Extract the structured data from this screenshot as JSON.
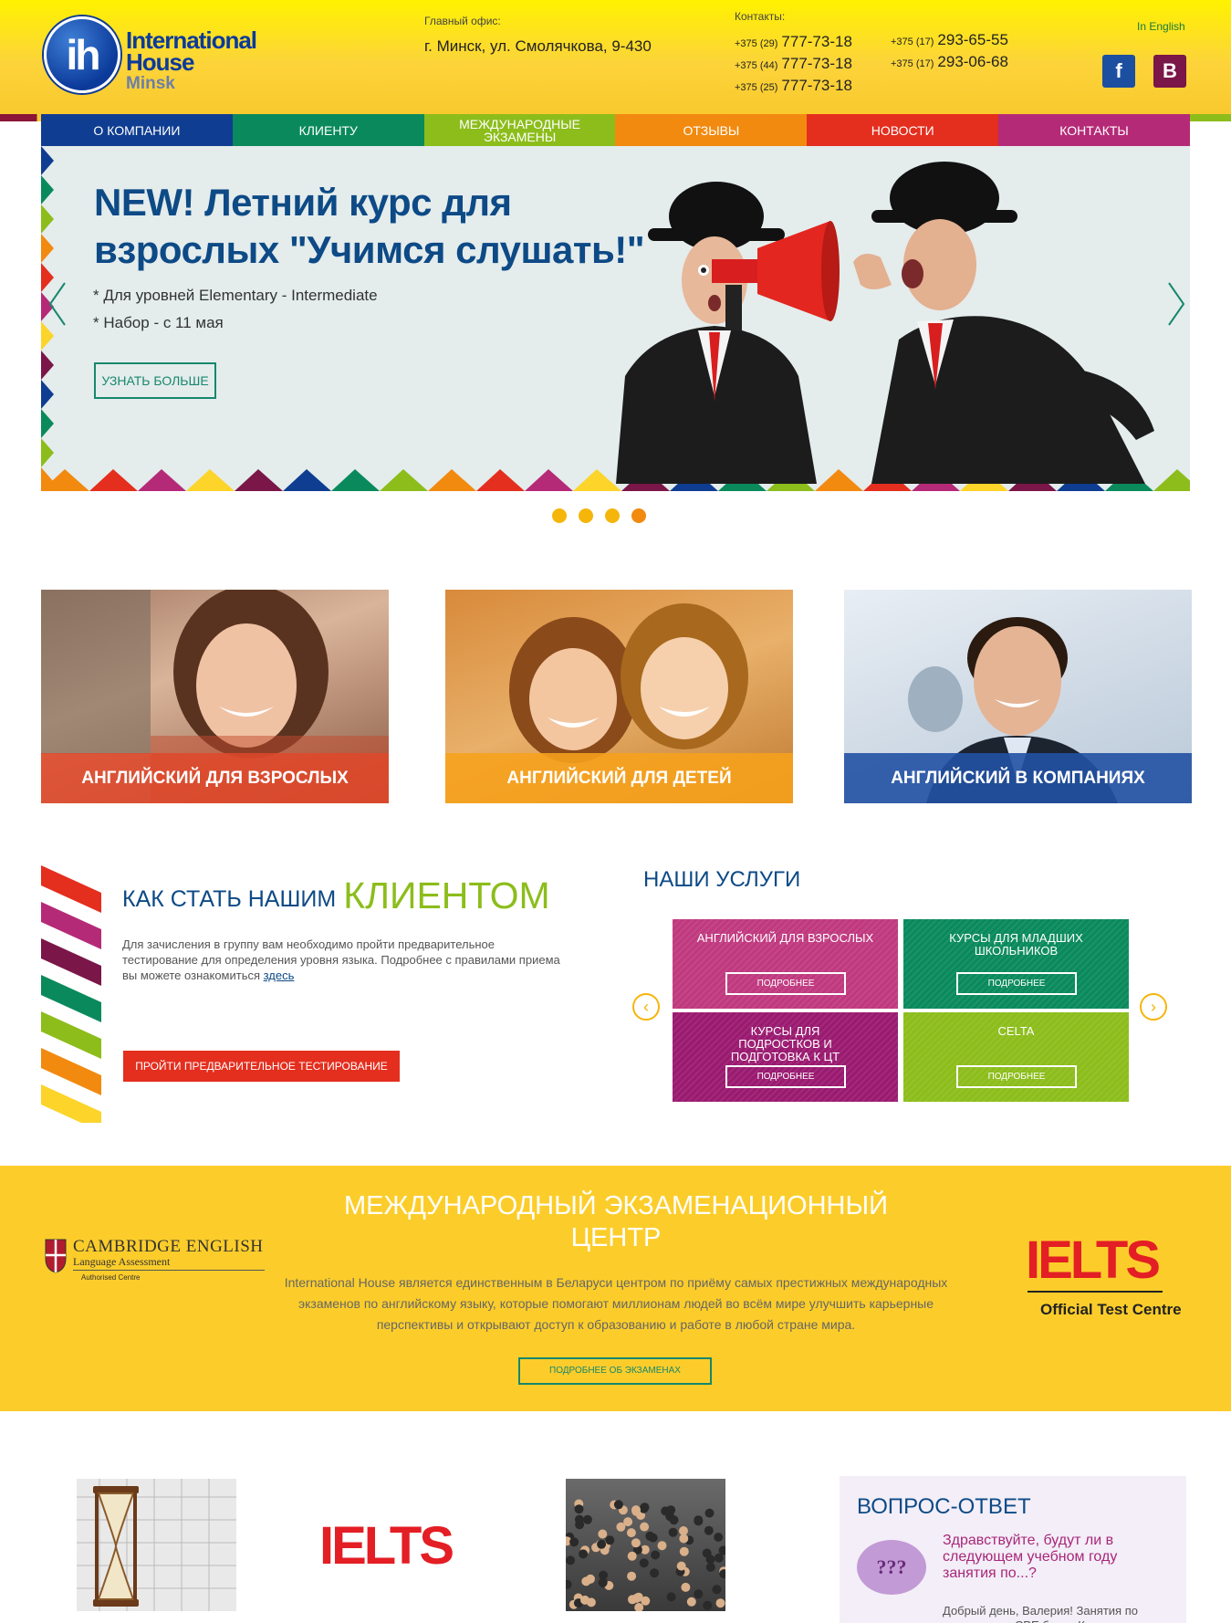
{
  "header": {
    "logo_text": "International House",
    "logo_sub": "Minsk",
    "logo_ih": "ih",
    "office_label": "Главный офис:",
    "office_address": "г. Минск, ул. Смолячкова, 9-430",
    "contacts_label": "Контакты:",
    "phones_left": [
      {
        "code": "+375 (29)",
        "number": "777-73-18"
      },
      {
        "code": "+375 (44)",
        "number": "777-73-18"
      },
      {
        "code": "+375 (25)",
        "number": "777-73-18"
      }
    ],
    "phones_right": [
      {
        "code": "+375 (17)",
        "number": "293-65-55"
      },
      {
        "code": "+375 (17)",
        "number": "293-06-68"
      }
    ],
    "lang_link": "In English",
    "facebook_glyph": "f",
    "vk_glyph": "B"
  },
  "nav": [
    {
      "label": "О КОМПАНИИ",
      "color": "#0f3d91"
    },
    {
      "label": "КЛИЕНТУ",
      "color": "#0a8a5c"
    },
    {
      "label": "МЕЖДУНАРОДНЫЕ ЭКЗАМЕНЫ",
      "color": "#8cbd1b"
    },
    {
      "label": "ОТЗЫВЫ",
      "color": "#f28a10"
    },
    {
      "label": "НОВОСТИ",
      "color": "#e42e1e"
    },
    {
      "label": "КОНТАКТЫ",
      "color": "#b52a77"
    }
  ],
  "slider": {
    "title_line1": "NEW! Летний курс для",
    "title_line2": "взрослых \"Учимся слушать!\"",
    "bullet1": "* Для уровней Elementary - Intermediate",
    "bullet2": "* Набор - с 11 мая",
    "button": "УЗНАТЬ БОЛЬШЕ",
    "slides_total": 4,
    "active_slide": 4
  },
  "categories": [
    {
      "label": "АНГЛИЙСКИЙ ДЛЯ ВЗРОСЛЫХ",
      "band_color": "#e0482a"
    },
    {
      "label": "АНГЛИЙСКИЙ ДЛЯ ДЕТЕЙ",
      "band_color": "#f7a21b"
    },
    {
      "label": "АНГЛИЙСКИЙ В КОМПАНИЯХ",
      "band_color": "#2251a3"
    }
  ],
  "client": {
    "title_small": "КАК СТАТЬ НАШИМ",
    "title_big": "КЛИЕНТОМ",
    "text": "Для зачисления в группу вам необходимо пройти предварительное тестирование для определения уровня языка. Подробнее с правилами приема вы можете ознакомиться ",
    "link": "здесь",
    "button": "ПРОЙТИ ПРЕДВАРИТЕЛЬНОЕ ТЕСТИРОВАНИЕ"
  },
  "services": {
    "title": "НАШИ УСЛУГИ",
    "prev_glyph": "‹",
    "next_glyph": "›",
    "items": [
      {
        "label": "АНГЛИЙСКИЙ ДЛЯ ВЗРОСЛЫХ",
        "button": "ПОДРОБНЕЕ",
        "color": "#c0397f"
      },
      {
        "label": "КУРСЫ ДЛЯ МЛАДШИХ ШКОЛЬНИКОВ",
        "button": "ПОДРОБНЕЕ",
        "color": "#0a8a5c"
      },
      {
        "label": "КУРСЫ ДЛЯ ПОДРОСТКОВ И ПОДГОТОВКА К ЦТ",
        "button": "ПОДРОБНЕЕ",
        "color": "#9a1a70"
      },
      {
        "label": "CELTA",
        "button": "ПОДРОБНЕЕ",
        "color": "#8cbd1b"
      }
    ]
  },
  "exam": {
    "title": "МЕЖДУНАРОДНЫЙ ЭКЗАМЕНАЦИОННЫЙ ЦЕНТР",
    "text": "International House является единственным в Беларуси центром по приёму самых престижных международных экзаменов по английскому языку, которые помогают миллионам людей во всём мире улучшить карьерные перспективы и открывают доступ к образованию и работе в любой стране мира.",
    "button": "ПОДРОБНЕЕ ОБ ЭКЗАМЕНАХ",
    "cambridge_title": "CAMBRIDGE ENGLISH",
    "cambridge_sub": "Language Assessment",
    "cambridge_auth": "Authorised Centre",
    "ielts_logo": "IELTS",
    "ielts_sub": "Official Test Centre"
  },
  "bottom": {
    "ielts_logo": "IELTS",
    "faq_title": "ВОПРОС-ОТВЕТ",
    "faq_question": "Здравствуйте, будут ли в следующем учебном году занятия по...?",
    "faq_answer": "Добрый день, Валерия! Занятия по подготовке к CPE будут. Курс",
    "faq_bubble": "???"
  }
}
